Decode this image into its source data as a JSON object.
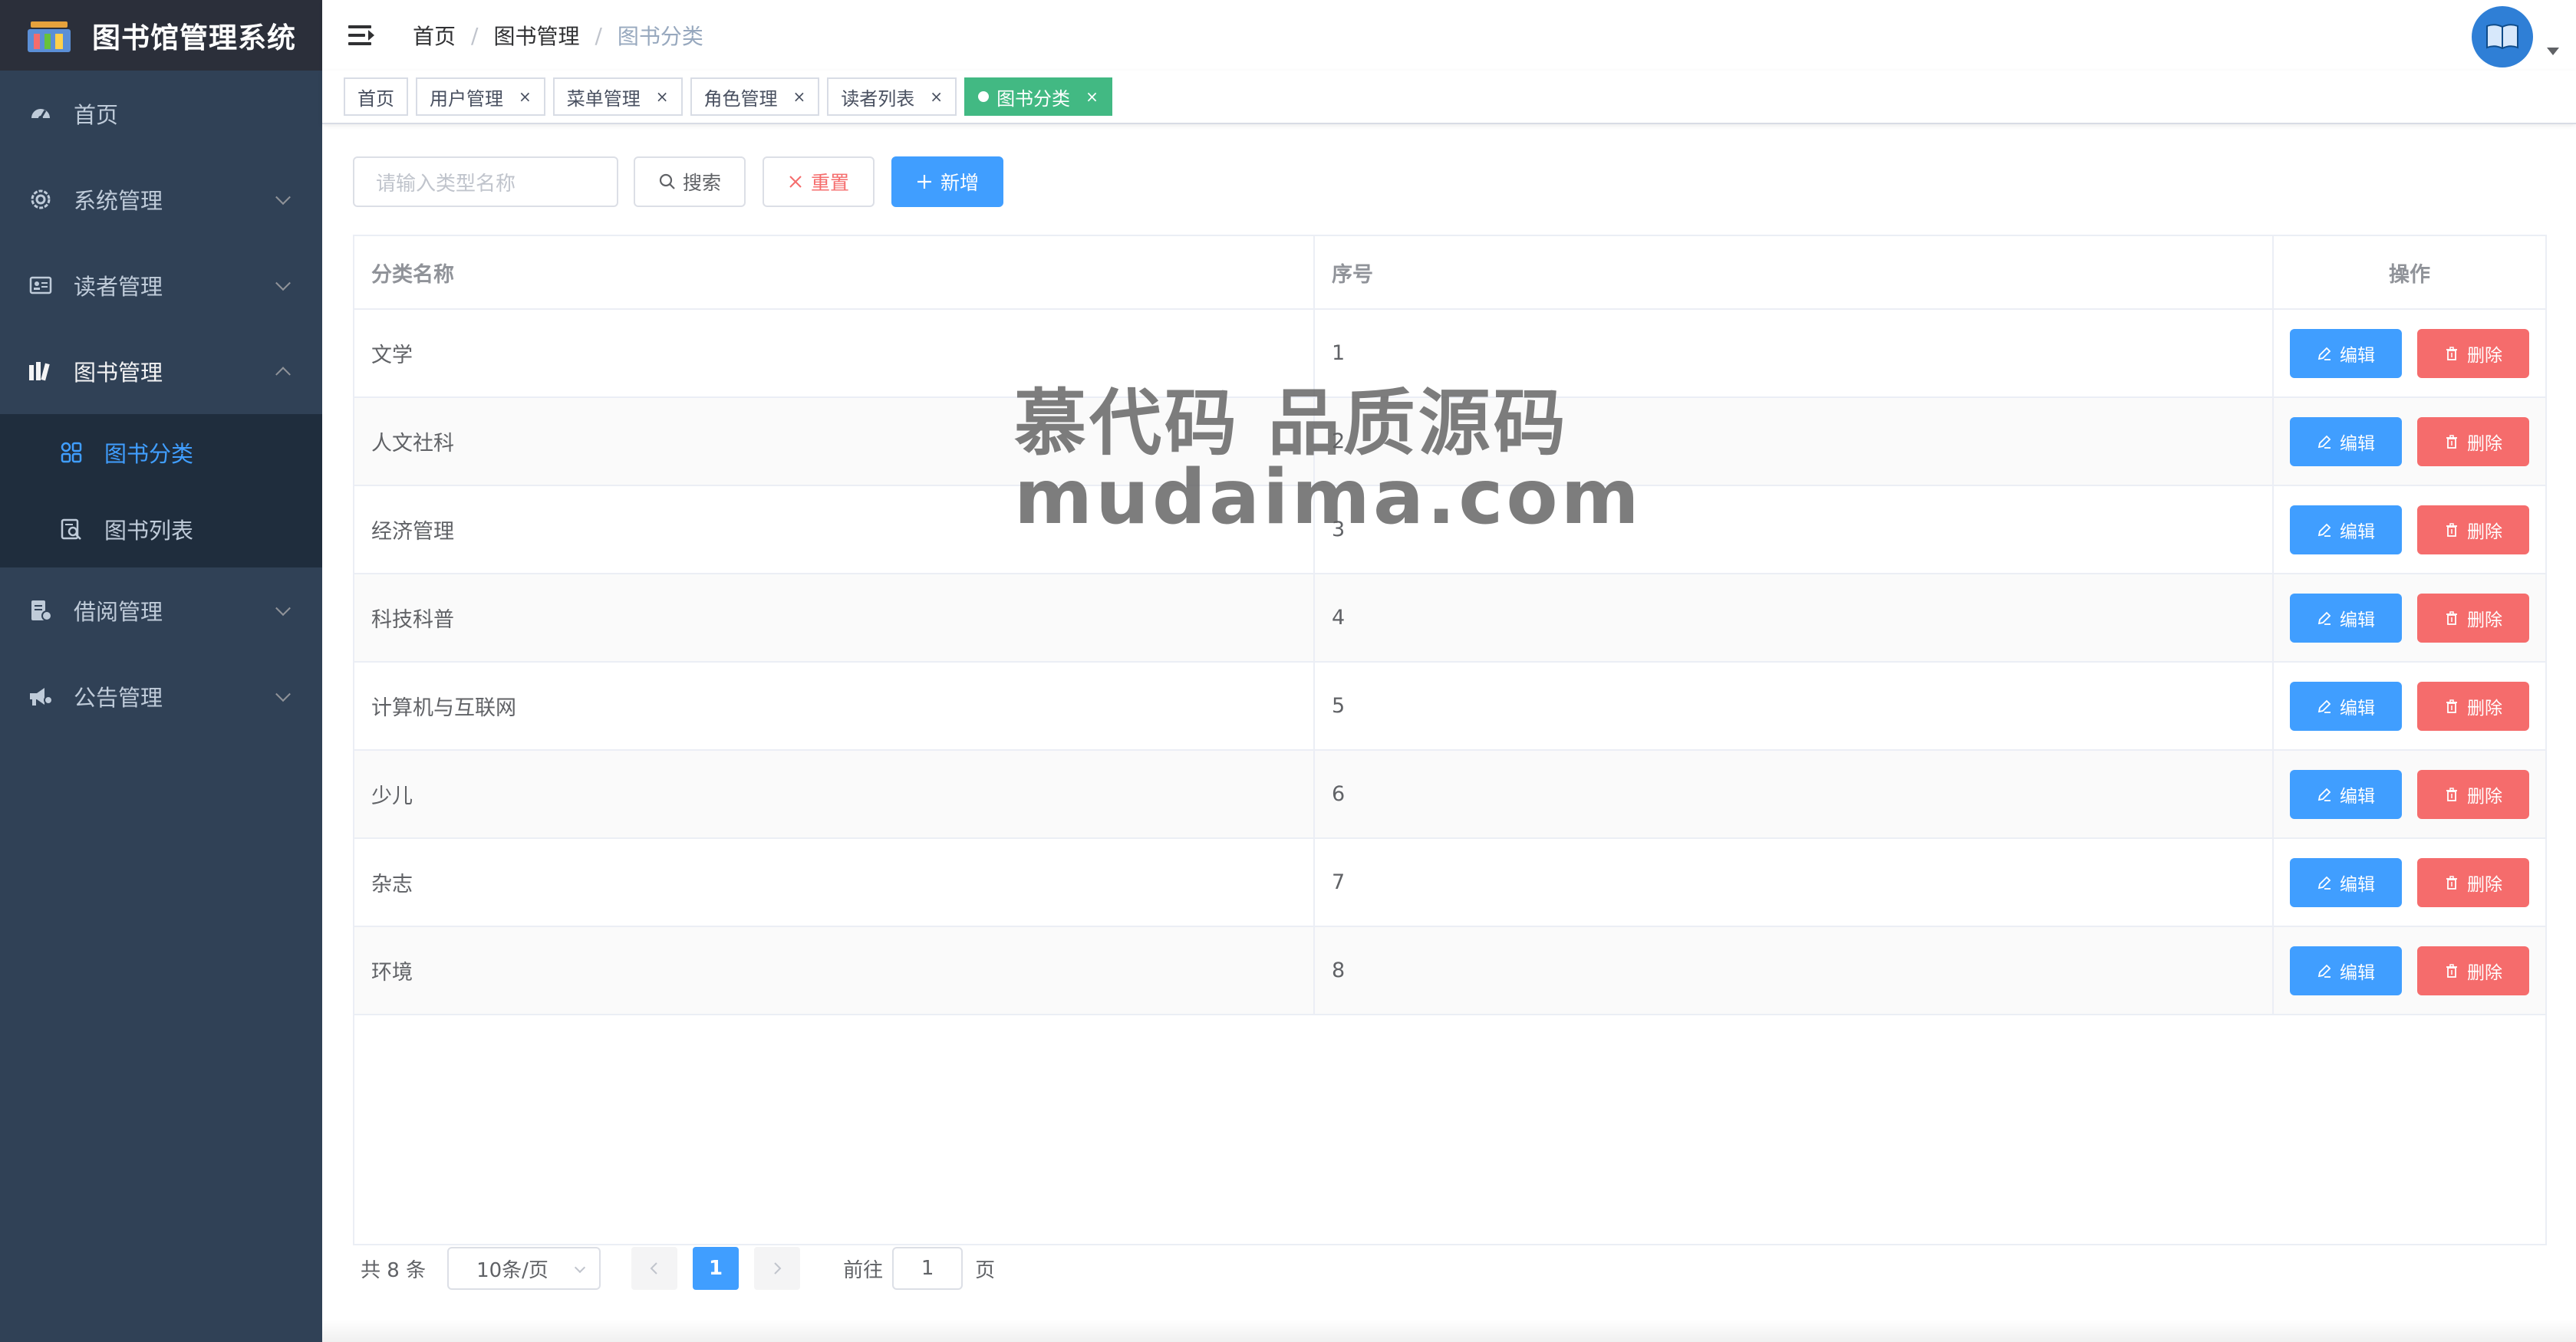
{
  "app": {
    "title": "图书馆管理系统",
    "logo_icon": "library-logo-icon"
  },
  "sidebar": {
    "items": [
      {
        "label": "首页",
        "icon": "dashboard-icon"
      },
      {
        "label": "系统管理",
        "icon": "gear-icon"
      },
      {
        "label": "读者管理",
        "icon": "id-card-icon"
      },
      {
        "label": "图书管理",
        "icon": "books-icon",
        "expanded": true
      },
      {
        "label": "借阅管理",
        "icon": "borrow-icon"
      },
      {
        "label": "公告管理",
        "icon": "megaphone-icon"
      }
    ],
    "submenu": [
      {
        "label": "图书分类",
        "icon": "grid-icon",
        "active": true
      },
      {
        "label": "图书列表",
        "icon": "list-search-icon"
      }
    ]
  },
  "header": {
    "breadcrumb": [
      "首页",
      "图书管理",
      "图书分类"
    ]
  },
  "tags": [
    {
      "label": "首页"
    },
    {
      "label": "用户管理",
      "close": "×"
    },
    {
      "label": "菜单管理",
      "close": "×"
    },
    {
      "label": "角色管理",
      "close": "×"
    },
    {
      "label": "读者列表",
      "close": "×"
    },
    {
      "label": "图书分类",
      "close": "×",
      "active": true
    }
  ],
  "toolbar": {
    "search_placeholder": "请输入类型名称",
    "search_label": "搜索",
    "reset_label": "重置",
    "add_label": "新增"
  },
  "table": {
    "headers": [
      "分类名称",
      "序号",
      "操作"
    ],
    "edit_label": "编辑",
    "delete_label": "删除",
    "rows": [
      {
        "name": "文学",
        "order": "1"
      },
      {
        "name": "人文社科",
        "order": "2"
      },
      {
        "name": "经济管理",
        "order": "3"
      },
      {
        "name": "科技科普",
        "order": "4"
      },
      {
        "name": "计算机与互联网",
        "order": "5"
      },
      {
        "name": "少儿",
        "order": "6"
      },
      {
        "name": "杂志",
        "order": "7"
      },
      {
        "name": "环境",
        "order": "8"
      }
    ]
  },
  "pagination": {
    "total": "共 8 条",
    "page_size": "10条/页",
    "current_page": "1",
    "goto_label": "前往",
    "goto_value": "1",
    "page_suffix": "页"
  },
  "watermark": {
    "line1": "慕代码 品质源码",
    "line2": "mudaima.com"
  },
  "colors": {
    "sidebar_bg": "#304156",
    "primary": "#409eff",
    "danger": "#f56c6c",
    "tag_active": "#42b983"
  }
}
